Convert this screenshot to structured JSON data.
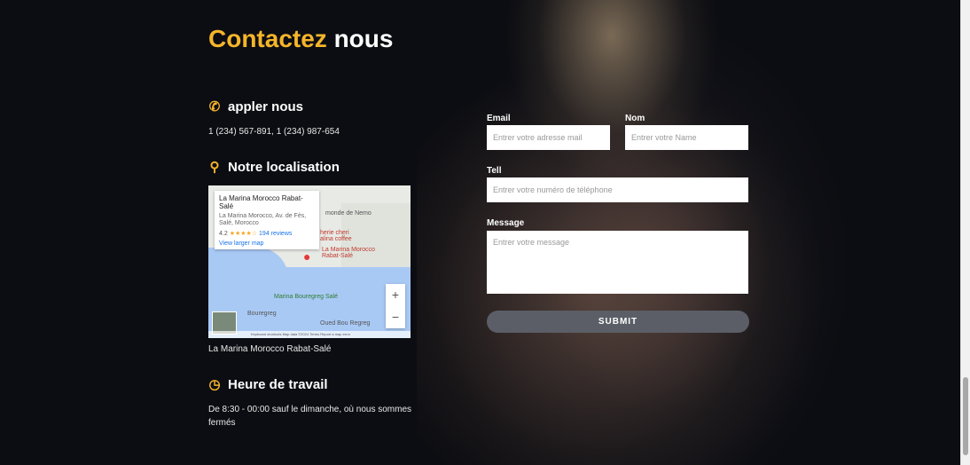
{
  "section": {
    "title_highlight": "Contactez",
    "title_rest": "nous"
  },
  "call": {
    "icon": "phone-icon",
    "heading": "appler nous",
    "numbers": "1 (234) 567-891, 1 (234) 987-654"
  },
  "location": {
    "icon": "map-pin-icon",
    "heading": "Notre localisation",
    "caption": "La Marina Morocco Rabat-Salé",
    "map": {
      "place_name": "La Marina Morocco Rabat-Salé",
      "address": "La Marina Morocco, Av. de Fès, Salé, Morocco",
      "rating": "4.2",
      "stars": "★★★★☆",
      "reviews": "194 reviews",
      "view_larger": "View larger map",
      "pin_label": "La Marina Morocco Rabat-Salé",
      "label_nemo": "monde de Nemo",
      "label_cafe": "herie cheri\nalina coffee",
      "label_marina": "Marina Bouregreg Salé",
      "label_bouregreg": "Bouregreg",
      "label_oued": "Oued Bou Regreg",
      "zoom_in": "+",
      "zoom_out": "−",
      "footer": "Keyboard shortcuts   Map data ©2024   Terms   Report a map error"
    }
  },
  "hours": {
    "icon": "clock-icon",
    "heading": "Heure de travail",
    "text": "De 8:30 - 00:00 sauf le dimanche, où nous sommes fermés"
  },
  "form": {
    "email_label": "Email",
    "email_placeholder": "Entrer votre adresse mail",
    "name_label": "Nom",
    "name_placeholder": "Entrer votre Name",
    "tel_label": "Tell",
    "tel_placeholder": "Entrer votre numéro de téléphone",
    "message_label": "Message",
    "message_placeholder": "Entrer votre message",
    "submit_label": "SUBMIT"
  },
  "colors": {
    "accent": "#f5b52a",
    "background": "#0c0d12",
    "submit": "#5b5e66"
  }
}
